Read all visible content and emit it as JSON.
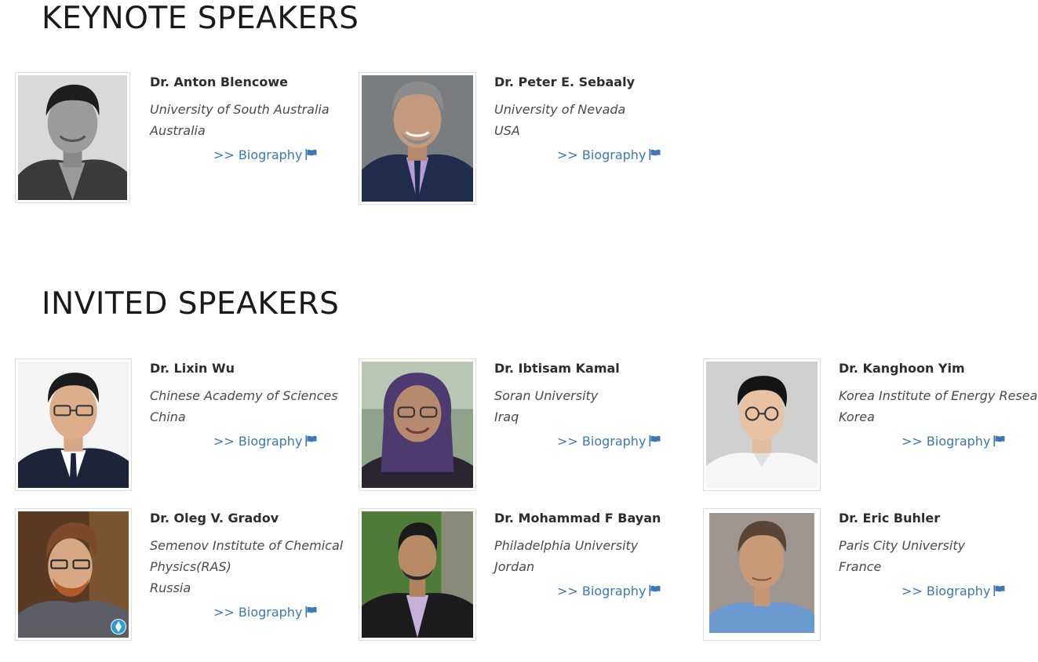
{
  "sections": {
    "keynote_title": "KEYNOTE SPEAKERS",
    "invited_title": "INVITED SPEAKERS"
  },
  "bio_link_label": ">> Biography",
  "link_color": "#3b78b4",
  "keynote": [
    {
      "name": "Dr. Anton Blencowe",
      "institution": "University of South Australia",
      "country": "Australia"
    },
    {
      "name": "Dr. Peter E. Sebaaly",
      "institution": "University of Nevada",
      "country": "USA"
    }
  ],
  "invited": [
    {
      "name": "Dr. Lixin Wu",
      "institution": "Chinese Academy of Sciences",
      "country": "China"
    },
    {
      "name": "Dr. Ibtisam Kamal",
      "institution": "Soran University",
      "country": "Iraq"
    },
    {
      "name": "Dr. Kanghoon Yim",
      "institution": "Korea Institute of Energy Research",
      "country": "Korea"
    },
    {
      "name": "Dr. Oleg V. Gradov",
      "institution_line1": "Semenov Institute of Chemical",
      "institution_line2": "Physics(RAS)",
      "country": "Russia"
    },
    {
      "name": "Dr. Mohammad F Bayan",
      "institution": "Philadelphia University",
      "country": "Jordan"
    },
    {
      "name": "Dr. Eric Buhler",
      "institution": "Paris City University",
      "country": "France"
    }
  ]
}
